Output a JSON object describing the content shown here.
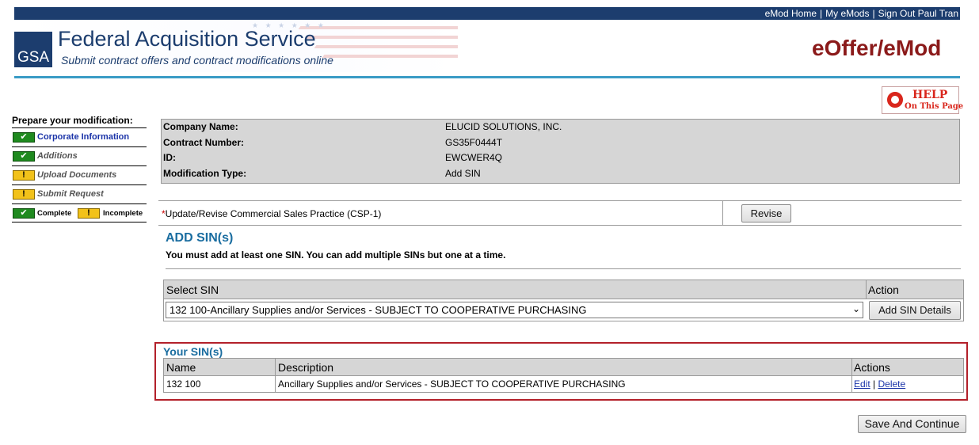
{
  "topnav": {
    "links": [
      "eMod Home",
      "My eMods",
      "Sign Out Paul Tran"
    ]
  },
  "header": {
    "logo_text": "GSA",
    "title": "Federal Acquisition Service",
    "subtitle": "Submit contract offers and contract modifications online",
    "app_name": "eOffer/eMod",
    "help_line1": "HELP",
    "help_line2": "On This Page"
  },
  "sidebar": {
    "title": "Prepare your modification:",
    "steps": [
      {
        "label": "Corporate Information",
        "status": "complete"
      },
      {
        "label": "Additions",
        "status": "complete"
      },
      {
        "label": "Upload Documents",
        "status": "incomplete"
      },
      {
        "label": "Submit Request",
        "status": "incomplete"
      }
    ],
    "legend_complete": "Complete",
    "legend_incomplete": "Incomplete"
  },
  "info": {
    "rows": [
      {
        "key": "Company Name:",
        "value": "ELUCID SOLUTIONS, INC."
      },
      {
        "key": "Contract Number:",
        "value": "GS35F0444T"
      },
      {
        "key": "ID:",
        "value": "EWCWER4Q"
      },
      {
        "key": "Modification Type:",
        "value": "Add SIN"
      }
    ]
  },
  "csp": {
    "required_mark": "*",
    "label": "Update/Revise Commercial Sales Practice (CSP-1)",
    "button": "Revise"
  },
  "add_sin": {
    "title": "ADD SIN(s)",
    "hint": "You must add at least one SIN. You can add multiple SINs but one at a time.",
    "col_select": "Select SIN",
    "col_action": "Action",
    "selected": "132 100-Ancillary Supplies and/or Services - SUBJECT TO COOPERATIVE PURCHASING",
    "button": "Add SIN Details"
  },
  "your_sins": {
    "title": "Your SIN(s)",
    "columns": [
      "Name",
      "Description",
      "Actions"
    ],
    "rows": [
      {
        "name": "132 100",
        "description": "Ancillary Supplies and/or Services - SUBJECT TO COOPERATIVE PURCHASING",
        "edit": "Edit",
        "sep": "|",
        "delete": "Delete"
      }
    ]
  },
  "footer": {
    "save_button": "Save And Continue"
  },
  "colors": {
    "brand_navy": "#1c3d6e",
    "accent_red": "#8b1a1a",
    "section_blue": "#1a6da0",
    "highlight_box": "#b3202a"
  }
}
